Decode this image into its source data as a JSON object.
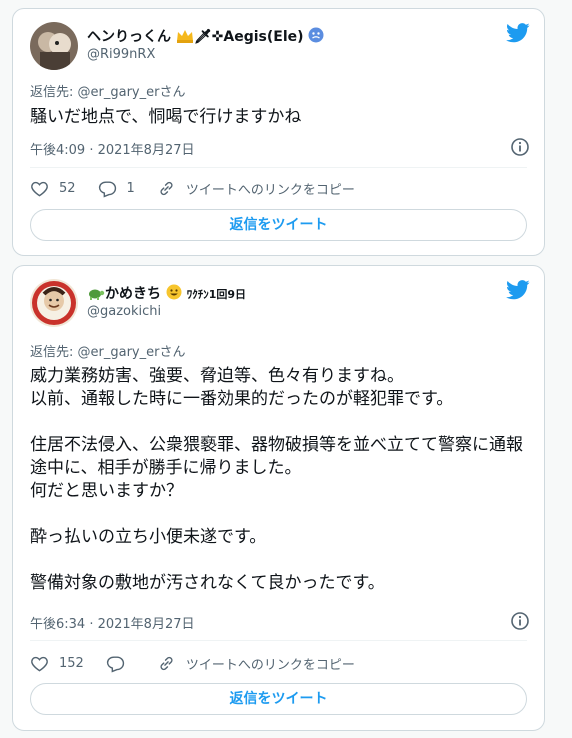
{
  "tweets": [
    {
      "name": "ヘンりっくん",
      "name_suffix": "🗡✜Aegis(Ele)",
      "handle": "@Ri99nRX",
      "reply_to": "返信先: @er_gary_erさん",
      "text": "騒いだ地点で、恫喝で行けますかね",
      "timestamp": "午後4:09 · 2021年8月27日",
      "likes": "52",
      "replies": "1",
      "copy_link": "ツイートへのリンクをコピー",
      "reply_button": "返信をツイート"
    },
    {
      "name": "かめきち",
      "name_suffix": "ﾜｸﾁﾝ1回9日",
      "handle": "@gazokichi",
      "reply_to": "返信先: @er_gary_erさん",
      "text": "威力業務妨害、強要、脅迫等、色々有りますね。\n以前、通報した時に一番効果的だったのが軽犯罪です。\n\n住居不法侵入、公衆猥褻罪、器物破損等を並べ立てて警察に通報途中に、相手が勝手に帰りました。\n何だと思いますか？\n\n酔っ払いの立ち小便未遂です。\n\n警備対象の敷地が汚されなくて良かったです。",
      "timestamp": "午後6:34 · 2021年8月27日",
      "likes": "152",
      "replies": "",
      "copy_link": "ツイートへのリンクをコピー",
      "reply_button": "返信をツイート"
    }
  ],
  "colors": {
    "accent": "#1d9bf0",
    "muted": "#536471",
    "border": "#cfd9de"
  }
}
